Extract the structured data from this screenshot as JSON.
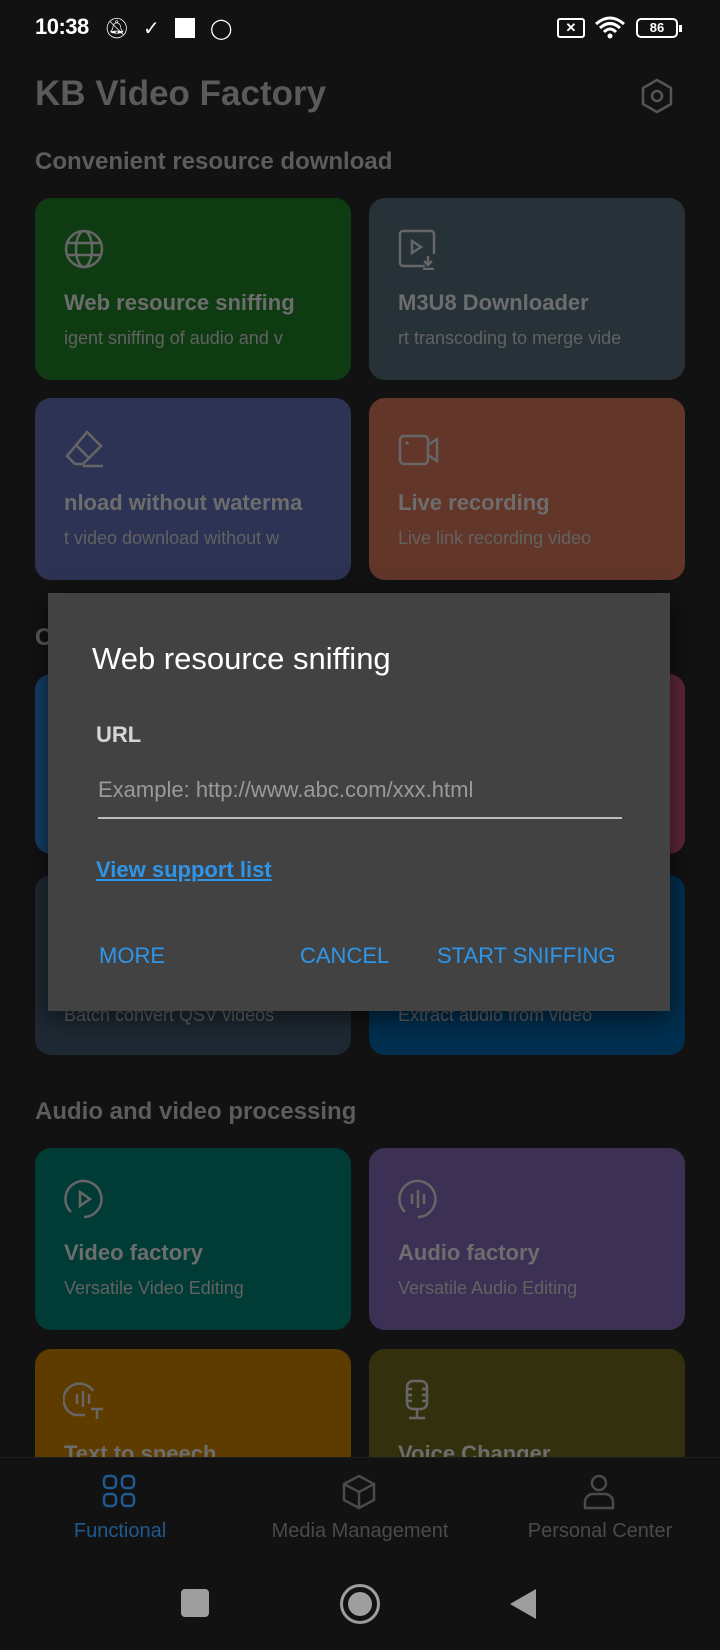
{
  "status_bar": {
    "time": "10:38",
    "battery": "86"
  },
  "header": {
    "title": "KB Video Factory",
    "settings_icon": "hexagon-settings-icon"
  },
  "sections": [
    {
      "title": "Convenient resource download",
      "cards": [
        {
          "title": "Web resource sniffing",
          "subtitle": "igent sniffing of audio and v",
          "color": "#0f3b12",
          "icon": "globe-icon"
        },
        {
          "title": "M3U8 Downloader",
          "subtitle": "rt transcoding to merge vide",
          "color": "#263238",
          "icon": "video-download-icon"
        },
        {
          "title": "nload without waterma",
          "subtitle": "t video download without w",
          "color": "#2d3354",
          "icon": "eraser-icon"
        },
        {
          "title": "Live recording",
          "subtitle": "Live link recording video",
          "color": "#62372a",
          "icon": "video-camera-icon"
        }
      ]
    },
    {
      "title": "C",
      "cards": [
        {
          "title": "",
          "subtitle": "",
          "color": "#153e66"
        },
        {
          "title": "",
          "subtitle": "",
          "color": "#5e2738"
        },
        {
          "title": "",
          "subtitle": "Batch convert QSV videos",
          "color": "#1e2933"
        },
        {
          "title": "",
          "subtitle": "Extract audio from video",
          "color": "#002f4f"
        }
      ]
    },
    {
      "title": "Audio and video processing",
      "cards": [
        {
          "title": "Video factory",
          "subtitle": "Versatile Video Editing",
          "color": "#003b35",
          "icon": "play-circle-icon"
        },
        {
          "title": "Audio factory",
          "subtitle": "Versatile Audio Editing",
          "color": "#3c3055",
          "icon": "audio-wave-icon"
        },
        {
          "title": "Text to speech",
          "subtitle": "",
          "color": "#5e3c00",
          "icon": "speech-bubble-icon"
        },
        {
          "title": "Voice Changer",
          "subtitle": "",
          "color": "#33300d",
          "icon": "microphone-icon"
        }
      ]
    }
  ],
  "dialog": {
    "title": "Web resource sniffing",
    "label": "URL",
    "input_value": "",
    "input_placeholder": "Example: http://www.abc.com/xxx.html",
    "link": "View support list",
    "more": "MORE",
    "cancel": "CANCEL",
    "start": "START SNIFFING",
    "accent": "#2f95e8"
  },
  "bottom_nav": [
    {
      "label": "Functional",
      "active": true,
      "color": "#1f5a8f"
    },
    {
      "label": "Media Management",
      "active": false
    },
    {
      "label": "Personal Center",
      "active": false
    }
  ]
}
